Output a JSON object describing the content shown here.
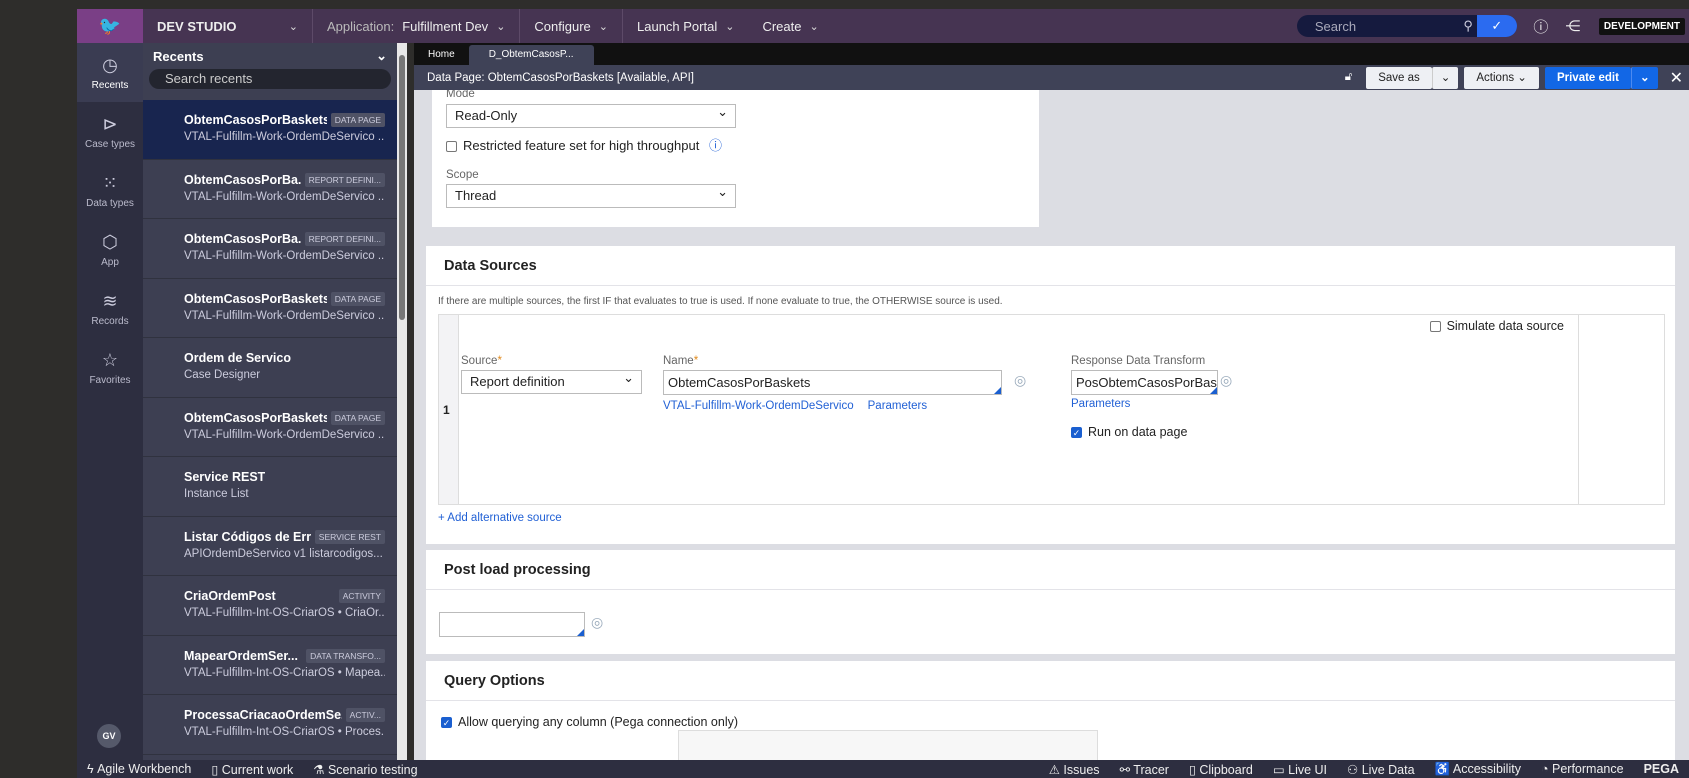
{
  "header": {
    "studio": "DEV STUDIO",
    "application_label": "Application:",
    "application": "Fulfillment Dev",
    "configure": "Configure",
    "launch_portal": "Launch Portal",
    "create": "Create",
    "search_placeholder": "Search",
    "environment": "DEVELOPMENT"
  },
  "rail": [
    {
      "label": "Recents",
      "icon": "clock-icon"
    },
    {
      "label": "Case types",
      "icon": "case-icon"
    },
    {
      "label": "Data types",
      "icon": "grid-icon"
    },
    {
      "label": "App",
      "icon": "cube-icon"
    },
    {
      "label": "Records",
      "icon": "layers-icon"
    },
    {
      "label": "Favorites",
      "icon": "star-icon"
    }
  ],
  "user_initials": "GV",
  "recents": {
    "title": "Recents",
    "search_placeholder": "Search recents",
    "items": [
      {
        "name": "ObtemCasosPorBaskets",
        "badge": "DATA PAGE",
        "sub": "VTAL-Fulfillm-Work-OrdemDeServico ...",
        "selected": true
      },
      {
        "name": "ObtemCasosPorBa...",
        "badge": "REPORT DEFINI...",
        "sub": "VTAL-Fulfillm-Work-OrdemDeServico ..."
      },
      {
        "name": "ObtemCasosPorBa...",
        "badge": "REPORT DEFINI...",
        "sub": "VTAL-Fulfillm-Work-OrdemDeServico ..."
      },
      {
        "name": "ObtemCasosPorBaskets",
        "badge": "DATA PAGE",
        "sub": "VTAL-Fulfillm-Work-OrdemDeServico ..."
      },
      {
        "name": "Ordem de Servico",
        "badge": "",
        "sub": "Case Designer"
      },
      {
        "name": "ObtemCasosPorBaskets",
        "badge": "DATA PAGE",
        "sub": "VTAL-Fulfillm-Work-OrdemDeServico ..."
      },
      {
        "name": "Service REST",
        "badge": "",
        "sub": "Instance List"
      },
      {
        "name": "Listar Códigos de Erros",
        "badge": "SERVICE REST",
        "sub": "APIOrdemDeServico v1 listarcodigos..."
      },
      {
        "name": "CriaOrdemPost",
        "badge": "ACTIVITY",
        "sub": "VTAL-Fulfillm-Int-OS-CriarOS • CriaOr..."
      },
      {
        "name": "MapearOrdemSer...",
        "badge": "DATA TRANSFO...",
        "sub": "VTAL-Fulfillm-Int-OS-CriarOS • Mapea..."
      },
      {
        "name": "ProcessaCriacaoOrdemSe...",
        "badge": "ACTIV...",
        "sub": "VTAL-Fulfillm-Int-OS-CriarOS • Proces..."
      }
    ]
  },
  "tabs": [
    "Home",
    "D_ObtemCasosP..."
  ],
  "titlebar": {
    "title": "Data Page: ObtemCasosPorBaskets [Available, API]",
    "save_as": "Save as",
    "actions": "Actions",
    "private_edit": "Private edit"
  },
  "settings": {
    "mode_label": "Mode",
    "mode": "Read-Only",
    "restricted_label": "Restricted feature set for high throughput",
    "restricted": false,
    "scope_label": "Scope",
    "scope": "Thread"
  },
  "data_sources": {
    "title": "Data Sources",
    "hint": "If there are multiple sources, the first IF that evaluates to true is used. If none evaluate to true, the OTHERWISE source is used.",
    "simulate_label": "Simulate data source",
    "simulate": false,
    "row_number": "1",
    "source_label": "Source",
    "source": "Report definition",
    "name_label": "Name",
    "name": "ObtemCasosPorBaskets",
    "class_link": "VTAL-Fulfillm-Work-OrdemDeServico",
    "parameters": "Parameters",
    "response_label": "Response Data Transform",
    "response": "PosObtemCasosPorBaskets",
    "response_parameters": "Parameters",
    "run_label": "Run on data page",
    "run": true,
    "add_alt": "+ Add alternative source"
  },
  "post_load": {
    "title": "Post load processing",
    "value": ""
  },
  "query": {
    "title": "Query Options",
    "allow_label": "Allow querying any column (Pega connection only)",
    "allow": true
  },
  "bottombar": {
    "agile": "Agile Workbench",
    "current": "Current work",
    "scenario": "Scenario testing",
    "issues": "Issues",
    "tracer": "Tracer",
    "clipboard": "Clipboard",
    "liveui": "Live UI",
    "livedata": "Live Data",
    "accessibility": "Accessibility",
    "performance": "Performance",
    "brand": "PEGA"
  },
  "colors": {
    "header": "#463452",
    "accent": "#1267e6",
    "selected_recent": "#18254f"
  }
}
